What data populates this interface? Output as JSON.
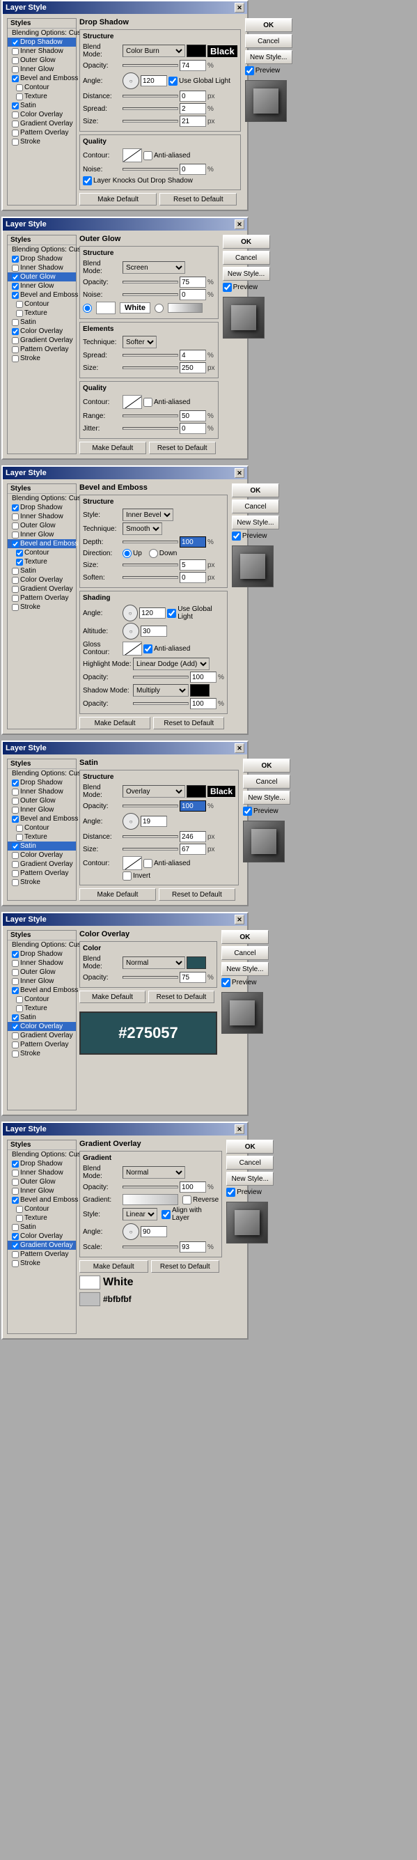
{
  "windows": [
    {
      "id": "drop-shadow",
      "title": "Layer Style",
      "section_name": "Drop Shadow",
      "styles_list": [
        {
          "label": "Styles",
          "checked": null,
          "active": false
        },
        {
          "label": "Blending Options: Custom",
          "checked": null,
          "active": false
        },
        {
          "label": "Drop Shadow",
          "checked": true,
          "active": true
        },
        {
          "label": "Inner Shadow",
          "checked": false,
          "active": false
        },
        {
          "label": "Outer Glow",
          "checked": false,
          "active": false
        },
        {
          "label": "Inner Glow",
          "checked": false,
          "active": false
        },
        {
          "label": "Bevel and Emboss",
          "checked": true,
          "active": false
        },
        {
          "label": "Contour",
          "checked": false,
          "active": false,
          "indent": true
        },
        {
          "label": "Texture",
          "checked": false,
          "active": false,
          "indent": true
        },
        {
          "label": "Satin",
          "checked": true,
          "active": false
        },
        {
          "label": "Color Overlay",
          "checked": false,
          "active": false
        },
        {
          "label": "Gradient Overlay",
          "checked": false,
          "active": false
        },
        {
          "label": "Pattern Overlay",
          "checked": false,
          "active": false
        },
        {
          "label": "Stroke",
          "checked": false,
          "active": false
        }
      ],
      "structure": {
        "blend_mode": "Color Burn",
        "blend_color": "black",
        "opacity": "74",
        "angle": "120",
        "use_global_light": true,
        "distance": "0",
        "spread": "2",
        "size": "21"
      },
      "quality": {
        "anti_aliased": false,
        "noise": "0",
        "layer_knocks_out": true
      },
      "buttons": {
        "ok": "OK",
        "cancel": "Cancel",
        "new_style": "New Style...",
        "preview": "Preview",
        "make_default": "Make Default",
        "reset_to_default": "Reset to Default"
      }
    },
    {
      "id": "outer-glow",
      "title": "Layer Style",
      "section_name": "Outer Glow",
      "styles_list": [
        {
          "label": "Styles",
          "checked": null,
          "active": false
        },
        {
          "label": "Blending Options: Custom",
          "checked": null,
          "active": false
        },
        {
          "label": "Drop Shadow",
          "checked": true,
          "active": false
        },
        {
          "label": "Inner Shadow",
          "checked": false,
          "active": false
        },
        {
          "label": "Outer Glow",
          "checked": true,
          "active": true
        },
        {
          "label": "Inner Glow",
          "checked": true,
          "active": false
        },
        {
          "label": "Bevel and Emboss",
          "checked": true,
          "active": false
        },
        {
          "label": "Contour",
          "checked": false,
          "active": false,
          "indent": true
        },
        {
          "label": "Texture",
          "checked": false,
          "active": false,
          "indent": true
        },
        {
          "label": "Satin",
          "checked": false,
          "active": false
        },
        {
          "label": "Color Overlay",
          "checked": true,
          "active": false
        },
        {
          "label": "Gradient Overlay",
          "checked": false,
          "active": false
        },
        {
          "label": "Pattern Overlay",
          "checked": false,
          "active": false
        },
        {
          "label": "Stroke",
          "checked": false,
          "active": false
        }
      ],
      "structure": {
        "blend_mode": "Screen",
        "opacity": "75",
        "noise": "0",
        "color_type": "color",
        "color": "white"
      },
      "elements": {
        "technique": "Softer",
        "spread": "4",
        "size": "250"
      },
      "quality": {
        "anti_aliased": false,
        "range": "50",
        "jitter": "0"
      }
    },
    {
      "id": "bevel-emboss",
      "title": "Layer Style",
      "section_name": "Bevel and Emboss",
      "styles_list": [
        {
          "label": "Styles",
          "checked": null,
          "active": false
        },
        {
          "label": "Blending Options: Custom",
          "checked": null,
          "active": false
        },
        {
          "label": "Drop Shadow",
          "checked": true,
          "active": false
        },
        {
          "label": "Inner Shadow",
          "checked": false,
          "active": false
        },
        {
          "label": "Outer Glow",
          "checked": false,
          "active": false
        },
        {
          "label": "Inner Glow",
          "checked": false,
          "active": false
        },
        {
          "label": "Bevel and Emboss",
          "checked": true,
          "active": true
        },
        {
          "label": "Contour",
          "checked": true,
          "active": false,
          "indent": true
        },
        {
          "label": "Texture",
          "checked": true,
          "active": false,
          "indent": true
        },
        {
          "label": "Satin",
          "checked": false,
          "active": false
        },
        {
          "label": "Color Overlay",
          "checked": false,
          "active": false
        },
        {
          "label": "Gradient Overlay",
          "checked": false,
          "active": false
        },
        {
          "label": "Pattern Overlay",
          "checked": false,
          "active": false
        },
        {
          "label": "Stroke",
          "checked": false,
          "active": false
        }
      ],
      "structure": {
        "style": "Inner Bevel",
        "technique": "Smooth",
        "depth": "100",
        "direction_up": true,
        "direction_down": false,
        "size": "5",
        "soften": "0"
      },
      "shading": {
        "angle": "120",
        "use_global_light": true,
        "altitude": "30",
        "gloss_contour": "linear",
        "anti_aliased": true,
        "highlight_mode": "Linear Dodge (Add)",
        "highlight_opacity": "100",
        "shadow_mode": "Multiply",
        "shadow_color": "black",
        "shadow_opacity": "100"
      }
    },
    {
      "id": "satin",
      "title": "Layer Style",
      "section_name": "Satin",
      "styles_list": [
        {
          "label": "Styles",
          "checked": null,
          "active": false
        },
        {
          "label": "Blending Options: Custom",
          "checked": null,
          "active": false
        },
        {
          "label": "Drop Shadow",
          "checked": true,
          "active": false
        },
        {
          "label": "Inner Shadow",
          "checked": false,
          "active": false
        },
        {
          "label": "Outer Glow",
          "checked": false,
          "active": false
        },
        {
          "label": "Inner Glow",
          "checked": false,
          "active": false
        },
        {
          "label": "Bevel and Emboss",
          "checked": true,
          "active": false
        },
        {
          "label": "Contour",
          "checked": false,
          "active": false,
          "indent": true
        },
        {
          "label": "Texture",
          "checked": false,
          "active": false,
          "indent": true
        },
        {
          "label": "Satin",
          "checked": true,
          "active": true
        },
        {
          "label": "Color Overlay",
          "checked": false,
          "active": false
        },
        {
          "label": "Gradient Overlay",
          "checked": false,
          "active": false
        },
        {
          "label": "Pattern Overlay",
          "checked": false,
          "active": false
        },
        {
          "label": "Stroke",
          "checked": false,
          "active": false
        }
      ],
      "structure": {
        "blend_mode": "Overlay",
        "color": "black",
        "opacity": "100",
        "angle": "19",
        "distance": "246",
        "size": "67",
        "contour": "linear",
        "anti_aliased": false,
        "invert": false
      }
    },
    {
      "id": "color-overlay",
      "title": "Layer Style",
      "section_name": "Color Overlay",
      "styles_list": [
        {
          "label": "Styles",
          "checked": null,
          "active": false
        },
        {
          "label": "Blending Options: Custom",
          "checked": null,
          "active": false
        },
        {
          "label": "Drop Shadow",
          "checked": true,
          "active": false
        },
        {
          "label": "Inner Shadow",
          "checked": false,
          "active": false
        },
        {
          "label": "Outer Glow",
          "checked": false,
          "active": false
        },
        {
          "label": "Inner Glow",
          "checked": false,
          "active": false
        },
        {
          "label": "Bevel and Emboss",
          "checked": true,
          "active": false
        },
        {
          "label": "Contour",
          "checked": false,
          "active": false,
          "indent": true
        },
        {
          "label": "Texture",
          "checked": false,
          "active": false,
          "indent": true
        },
        {
          "label": "Satin",
          "checked": true,
          "active": false
        },
        {
          "label": "Color Overlay",
          "checked": true,
          "active": true
        },
        {
          "label": "Gradient Overlay",
          "checked": false,
          "active": false
        },
        {
          "label": "Pattern Overlay",
          "checked": false,
          "active": false
        },
        {
          "label": "Stroke",
          "checked": false,
          "active": false
        }
      ],
      "color_settings": {
        "blend_mode": "Normal",
        "color_swatch": "#275057",
        "opacity": "75",
        "color_display": "#275057"
      }
    },
    {
      "id": "gradient-overlay",
      "title": "Layer Style",
      "section_name": "Gradient Overlay",
      "styles_list": [
        {
          "label": "Styles",
          "checked": null,
          "active": false
        },
        {
          "label": "Blending Options: Custom",
          "checked": null,
          "active": false
        },
        {
          "label": "Drop Shadow",
          "checked": true,
          "active": false
        },
        {
          "label": "Inner Shadow",
          "checked": false,
          "active": false
        },
        {
          "label": "Outer Glow",
          "checked": false,
          "active": false
        },
        {
          "label": "Inner Glow",
          "checked": false,
          "active": false
        },
        {
          "label": "Bevel and Emboss",
          "checked": true,
          "active": false
        },
        {
          "label": "Contour",
          "checked": false,
          "active": false,
          "indent": true
        },
        {
          "label": "Texture",
          "checked": false,
          "active": false,
          "indent": true
        },
        {
          "label": "Satin",
          "checked": false,
          "active": false
        },
        {
          "label": "Color Overlay",
          "checked": true,
          "active": false
        },
        {
          "label": "Gradient Overlay",
          "checked": true,
          "active": true
        },
        {
          "label": "Pattern Overlay",
          "checked": false,
          "active": false
        },
        {
          "label": "Stroke",
          "checked": false,
          "active": false
        }
      ],
      "gradient_settings": {
        "blend_mode": "Normal",
        "opacity": "100",
        "style": "Linear",
        "align_with_layer": true,
        "angle": "90",
        "scale": "93",
        "reverse": false,
        "gradient_from": "White",
        "gradient_to": "#bfbfbf"
      }
    }
  ],
  "labels": {
    "structure": "Structure",
    "blend_mode": "Blend Mode:",
    "opacity": "Opacity:",
    "angle": "Angle:",
    "distance": "Distance:",
    "spread": "Spread:",
    "size": "Size:",
    "quality": "Quality",
    "contour": "Contour:",
    "anti_aliased": "Anti-aliased",
    "noise": "Noise:",
    "layer_knocks_out": "Layer Knocks Out Drop Shadow",
    "make_default": "Make Default",
    "reset_to_default": "Reset to Default",
    "elements": "Elements",
    "technique": "Technique:",
    "range": "Range:",
    "jitter": "Jitter:",
    "shading": "Shading",
    "altitude": "Altitude:",
    "gloss_contour": "Gloss Contour:",
    "highlight_mode": "Highlight Mode:",
    "shadow_mode": "Shadow Mode:",
    "style": "Style:",
    "depth": "Depth:",
    "direction": "Direction:",
    "soften": "Soften:",
    "up": "Up",
    "down": "Down",
    "use_global_light": "Use Global Light",
    "invert": "Invert",
    "color": "Color",
    "gradient": "Gradient",
    "gradient_label": "Gradient:",
    "style_label": "Style:",
    "align_with_layer": "Align with Layer",
    "scale": "Scale:",
    "reverse": "Reverse",
    "ok": "OK",
    "cancel": "Cancel",
    "new_style": "New Style...",
    "preview": "Preview",
    "px": "px",
    "percent": "%",
    "black_text": "Black",
    "white_text": "White"
  }
}
